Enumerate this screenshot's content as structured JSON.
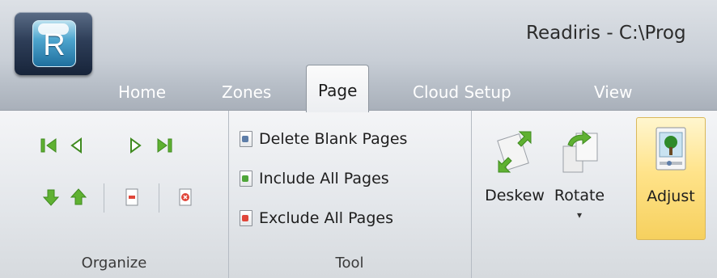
{
  "window": {
    "title": "Readiris - C:\\Prog"
  },
  "app_button": {
    "logo_letter": "R"
  },
  "tabs": [
    {
      "label": "Home"
    },
    {
      "label": "Zones"
    },
    {
      "label": "Page",
      "active": true
    },
    {
      "label": "Cloud Setup"
    },
    {
      "label": "View"
    }
  ],
  "groups": {
    "organize": {
      "label": "Organize"
    },
    "tool": {
      "label": "Tool",
      "items": [
        {
          "label": "Delete Blank Pages",
          "icon": "delete-blank-pages-icon"
        },
        {
          "label": "Include All Pages",
          "icon": "include-all-pages-icon"
        },
        {
          "label": "Exclude All Pages",
          "icon": "exclude-all-pages-icon"
        }
      ]
    },
    "image": {
      "buttons": [
        {
          "label": "Deskew",
          "icon": "deskew-icon"
        },
        {
          "label": "Rotate",
          "icon": "rotate-icon",
          "dropdown": "▾"
        },
        {
          "label": "Adjust",
          "icon": "adjust-icon",
          "highlighted": true
        }
      ]
    }
  },
  "colors": {
    "arrow_green": "#5fb132",
    "arrow_green_dark": "#3f8a1f",
    "exclude_red": "#e0463a",
    "include_green": "#4fa63a",
    "highlight_yellow": "#ffe38a"
  }
}
